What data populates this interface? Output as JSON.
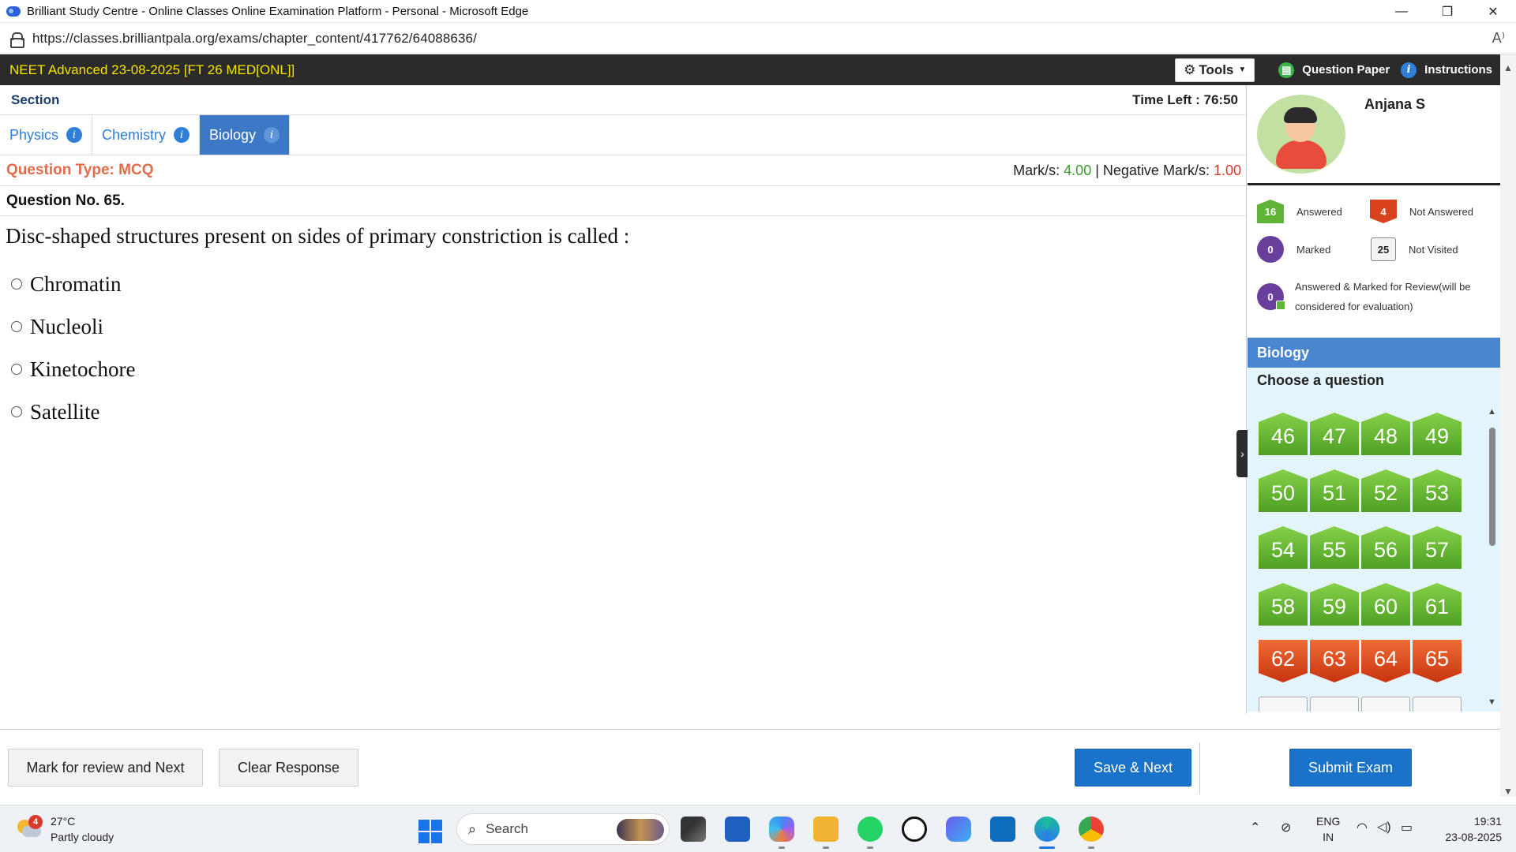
{
  "browser": {
    "title": "Brilliant Study Centre - Online Classes Online Examination Platform - Personal - Microsoft Edge",
    "url": "https://classes.brilliantpala.org/exams/chapter_content/417762/64088636/",
    "controls": {
      "minimize": "—",
      "restore": "❐",
      "close": "✕"
    },
    "read_aloud": "A⁾"
  },
  "exam": {
    "title": "NEET Advanced 23-08-2025 [FT 26 MED[ONL]]",
    "tools_label": "Tools",
    "question_paper_label": "Question Paper",
    "instructions_label": "Instructions"
  },
  "section": {
    "label": "Section",
    "time_left": "Time Left : 76:50",
    "tabs": [
      {
        "label": "Physics",
        "active": false
      },
      {
        "label": "Chemistry",
        "active": false
      },
      {
        "label": "Biology",
        "active": true
      }
    ]
  },
  "question": {
    "type_label": "Question Type: MCQ",
    "marks_prefix": "Mark/s: ",
    "marks": "4.00",
    "neg_prefix": " | Negative Mark/s: ",
    "neg_marks": "1.00",
    "number_label": "Question No. 65.",
    "text": "Disc-shaped structures present on sides of primary constriction is called :",
    "options": [
      "Chromatin",
      "Nucleoli",
      "Kinetochore",
      "Satellite"
    ]
  },
  "candidate": {
    "name": "Anjana S"
  },
  "legend": {
    "answered": {
      "count": "16",
      "label": "Answered"
    },
    "not_answered": {
      "count": "4",
      "label": "Not Answered"
    },
    "marked": {
      "count": "0",
      "label": "Marked"
    },
    "not_visited": {
      "count": "25",
      "label": "Not Visited"
    },
    "answered_marked": {
      "count": "0",
      "label": "Answered & Marked for Review(will be considered for evaluation)"
    }
  },
  "palette": {
    "section_name": "Biology",
    "choose_label": "Choose a question",
    "questions": [
      {
        "n": "46",
        "status": "answered"
      },
      {
        "n": "47",
        "status": "answered"
      },
      {
        "n": "48",
        "status": "answered"
      },
      {
        "n": "49",
        "status": "answered"
      },
      {
        "n": "50",
        "status": "answered"
      },
      {
        "n": "51",
        "status": "answered"
      },
      {
        "n": "52",
        "status": "answered"
      },
      {
        "n": "53",
        "status": "answered"
      },
      {
        "n": "54",
        "status": "answered"
      },
      {
        "n": "55",
        "status": "answered"
      },
      {
        "n": "56",
        "status": "answered"
      },
      {
        "n": "57",
        "status": "answered"
      },
      {
        "n": "58",
        "status": "answered"
      },
      {
        "n": "59",
        "status": "answered"
      },
      {
        "n": "60",
        "status": "answered"
      },
      {
        "n": "61",
        "status": "answered"
      },
      {
        "n": "62",
        "status": "not_answered"
      },
      {
        "n": "63",
        "status": "not_answered"
      },
      {
        "n": "64",
        "status": "not_answered"
      },
      {
        "n": "65",
        "status": "not_answered"
      },
      {
        "n": "",
        "status": "not_visited"
      },
      {
        "n": "",
        "status": "not_visited"
      },
      {
        "n": "",
        "status": "not_visited"
      },
      {
        "n": "",
        "status": "not_visited"
      }
    ]
  },
  "footer": {
    "mark_review_label": "Mark for review and Next",
    "clear_label": "Clear Response",
    "save_next_label": "Save & Next",
    "submit_label": "Submit Exam"
  },
  "taskbar": {
    "weather_badge": "4",
    "temperature": "27°C",
    "condition": "Partly cloudy",
    "search_label": "Search",
    "lang_top": "ENG",
    "lang_bottom": "IN",
    "time": "19:31",
    "date": "23-08-2025"
  },
  "colors": {
    "answered": "#5fb336",
    "not_answered": "#d8421c",
    "marked": "#6a3f9b",
    "accent": "#1a73c9",
    "header_bg": "#2b2b2b",
    "exam_title": "#f5e400"
  }
}
